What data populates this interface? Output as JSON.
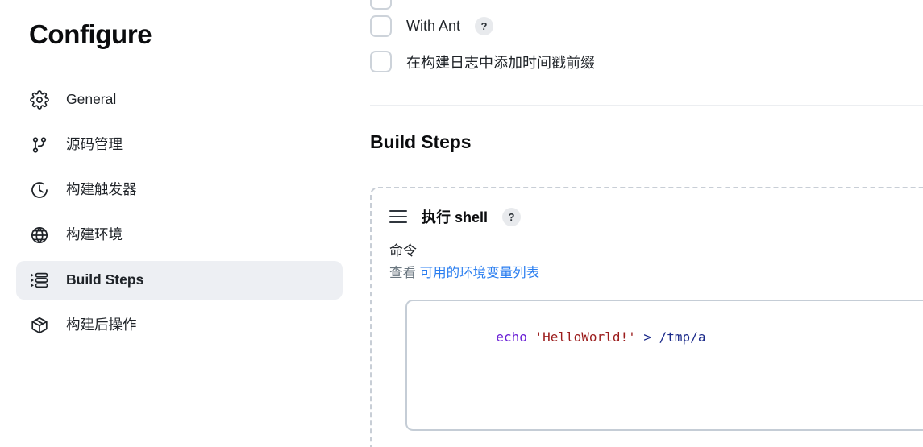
{
  "sidebar": {
    "title": "Configure",
    "items": [
      {
        "label": "General",
        "icon": "gear-icon",
        "active": false
      },
      {
        "label": "源码管理",
        "icon": "git-branch-icon",
        "active": false
      },
      {
        "label": "构建触发器",
        "icon": "clock-icon",
        "active": false
      },
      {
        "label": "构建环境",
        "icon": "globe-icon",
        "active": false
      },
      {
        "label": "Build Steps",
        "icon": "list-icon",
        "active": true
      },
      {
        "label": "构建后操作",
        "icon": "package-icon",
        "active": false
      }
    ]
  },
  "main": {
    "checkboxes": [
      {
        "label": "",
        "checked": false,
        "help": ""
      },
      {
        "label": "With Ant",
        "checked": false,
        "help": "?"
      },
      {
        "label": "在构建日志中添加时间戳前缀",
        "checked": false,
        "help": ""
      }
    ],
    "section_title": "Build Steps",
    "step": {
      "drag_handle": "drag-handle-icon",
      "name": "执行 shell",
      "help": "?",
      "field_label": "命令",
      "env_prefix": "查看",
      "env_link": "可用的环境变量列表",
      "command": {
        "full": "echo 'HelloWorld!' > /tmp/a",
        "tokens": [
          {
            "text": "echo",
            "type": "command"
          },
          {
            "text": " ",
            "type": "plain"
          },
          {
            "text": "'HelloWorld!'",
            "type": "string"
          },
          {
            "text": " ",
            "type": "plain"
          },
          {
            "text": ">",
            "type": "operator"
          },
          {
            "text": " ",
            "type": "plain"
          },
          {
            "text": "/tmp/a",
            "type": "path"
          }
        ]
      }
    }
  },
  "colors": {
    "active_nav_bg": "#edeff3",
    "link_blue": "#2a7ef0",
    "divider": "#eceef1",
    "dashed_border": "#c8ced6",
    "token_command": "#6b21d6",
    "token_string": "#9b1c1c",
    "token_operator": "#1b2a8a"
  }
}
